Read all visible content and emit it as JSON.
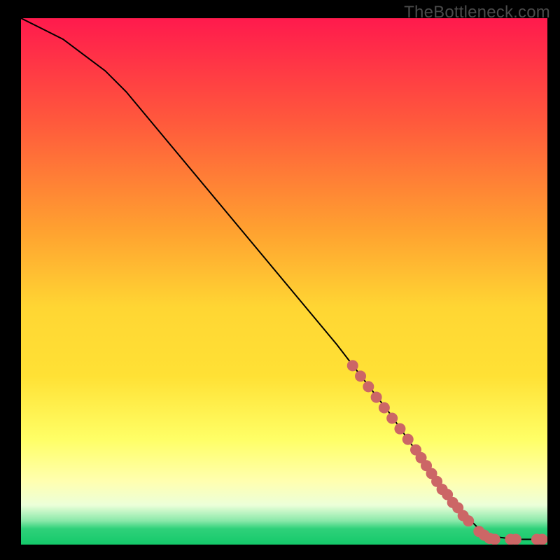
{
  "watermark": "TheBottleneck.com",
  "chart_data": {
    "type": "line",
    "title": "",
    "xlabel": "",
    "ylabel": "",
    "xlim": [
      0,
      100
    ],
    "ylim": [
      0,
      100
    ],
    "grid": false,
    "legend": false,
    "series": [
      {
        "name": "curve",
        "x": [
          0,
          4,
          8,
          12,
          16,
          20,
          30,
          40,
          50,
          60,
          70,
          77,
          80,
          83,
          85,
          87,
          90,
          94,
          98,
          100
        ],
        "y": [
          100,
          98,
          96,
          93,
          90,
          86,
          74,
          62,
          50,
          38,
          25,
          15,
          11,
          7,
          5,
          3,
          1.5,
          1,
          1,
          1
        ],
        "stroke": "#000000",
        "stroke_width": 2
      }
    ],
    "markers": {
      "name": "dots",
      "color": "#cc6666",
      "radius": 8,
      "points": [
        {
          "x": 63,
          "y": 34
        },
        {
          "x": 64.5,
          "y": 32
        },
        {
          "x": 66,
          "y": 30
        },
        {
          "x": 67.5,
          "y": 28
        },
        {
          "x": 69,
          "y": 26
        },
        {
          "x": 70.5,
          "y": 24
        },
        {
          "x": 72,
          "y": 22
        },
        {
          "x": 73.5,
          "y": 20
        },
        {
          "x": 75,
          "y": 18
        },
        {
          "x": 76,
          "y": 16.5
        },
        {
          "x": 77,
          "y": 15
        },
        {
          "x": 78,
          "y": 13.5
        },
        {
          "x": 79,
          "y": 12
        },
        {
          "x": 80,
          "y": 10.5
        },
        {
          "x": 81,
          "y": 9.5
        },
        {
          "x": 82,
          "y": 8
        },
        {
          "x": 83,
          "y": 7
        },
        {
          "x": 84,
          "y": 5.5
        },
        {
          "x": 85,
          "y": 4.5
        },
        {
          "x": 87,
          "y": 2.5
        },
        {
          "x": 88,
          "y": 1.8
        },
        {
          "x": 89,
          "y": 1.2
        },
        {
          "x": 90,
          "y": 1
        },
        {
          "x": 93,
          "y": 1
        },
        {
          "x": 94,
          "y": 1
        },
        {
          "x": 98,
          "y": 1
        },
        {
          "x": 99,
          "y": 1
        }
      ]
    }
  }
}
